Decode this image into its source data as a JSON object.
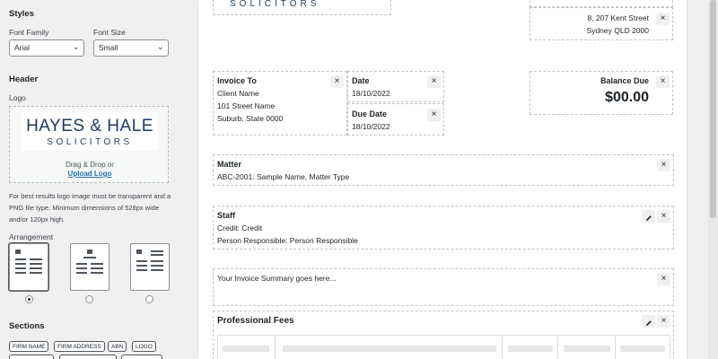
{
  "sidebar": {
    "styles_heading": "Styles",
    "font_family_label": "Font Family",
    "font_family_value": "Arial",
    "font_size_label": "Font Size",
    "font_size_value": "Small",
    "header_heading": "Header",
    "logo_label": "Logo",
    "logo_text_line1": "HAYES & HALE",
    "logo_text_line2": "SOLICITORS",
    "drag_drop_text": "Drag & Drop or",
    "upload_link": "Upload Logo",
    "help_text": "For best results logo image must be transparent and a PNG file type. Minimum dimensions of 528px wide and/or 120px high.",
    "arrangement_label": "Arrangement",
    "sections_heading": "Sections",
    "section_tags": [
      "FIRM NAME",
      "FIRM ADDRESS",
      "ABN",
      "LOGO"
    ]
  },
  "invoice": {
    "header_logo_partial": "SOLICITORS",
    "firm_address_line1": "8, 207 Kent Street",
    "firm_address_line2": "Sydney QLD 2000",
    "invoice_to_title": "Invoice To",
    "invoice_to_lines": [
      "Client Name",
      "101 Street Name",
      "Suburb, State 0000"
    ],
    "date_title": "Date",
    "date_value": "18/10/2022",
    "due_date_title": "Due Date",
    "due_date_value": "18/10/2022",
    "balance_due_title": "Balance Due",
    "balance_due_value": "$00.00",
    "matter_title": "Matter",
    "matter_value": "ABC-2001: Sample Name, Matter Type",
    "staff_title": "Staff",
    "staff_credit": "Credit: Credit",
    "staff_responsible": "Person Responsible: Person Responsible",
    "summary_text": "Your Invoice Summary goes here...",
    "professional_fees_title": "Professional Fees"
  },
  "icons": {
    "close": "×",
    "chevron": "⌄"
  },
  "colors": {
    "brand_navy": "#1e3a5f",
    "link_blue": "#2271b1"
  }
}
